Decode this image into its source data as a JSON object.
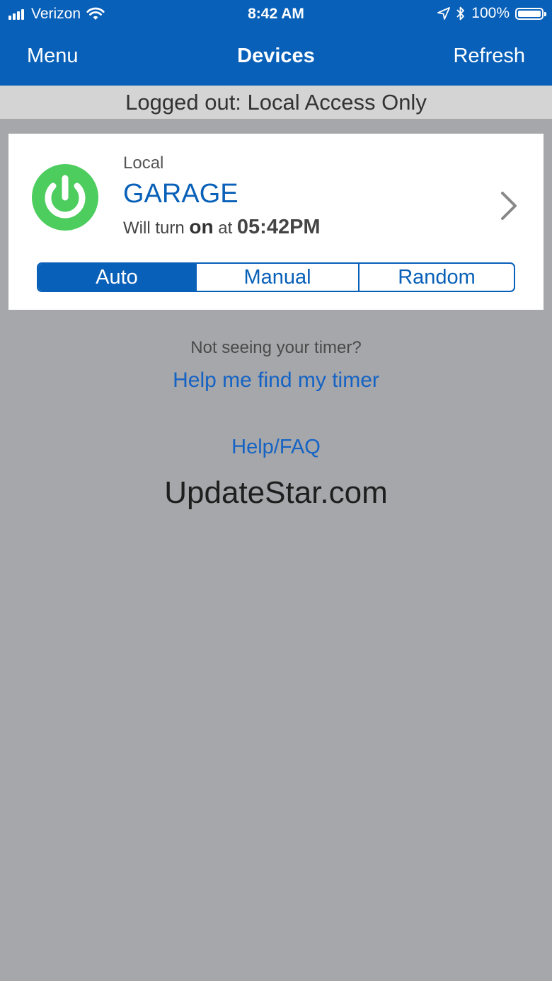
{
  "status_bar": {
    "carrier": "Verizon",
    "time": "8:42 AM",
    "battery": "100%"
  },
  "nav": {
    "menu_label": "Menu",
    "title": "Devices",
    "refresh_label": "Refresh"
  },
  "banner": {
    "text": "Logged out: Local Access Only"
  },
  "device": {
    "access_label": "Local",
    "name": "GARAGE",
    "schedule_prefix": "Will turn",
    "schedule_state": "on",
    "schedule_at": "at",
    "schedule_time": "05:42PM",
    "power_color": "#4ccd5e"
  },
  "modes": {
    "items": [
      "Auto",
      "Manual",
      "Random"
    ],
    "selected": "Auto"
  },
  "help": {
    "question": "Not seeing your timer?",
    "find_link": "Help me find my timer",
    "faq_link": "Help/FAQ"
  },
  "watermark": "UpdateStar.com",
  "colors": {
    "brand_blue": "#0860b8",
    "background": "#a6a7ab",
    "banner": "#d4d4d4"
  }
}
